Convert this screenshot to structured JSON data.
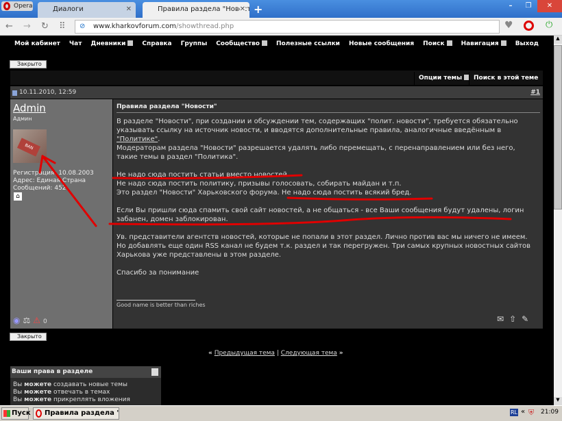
{
  "browser": {
    "name": "Opera",
    "tabs": [
      {
        "label": "Диалоги"
      },
      {
        "label": "Правила раздела \"Новости\""
      }
    ],
    "url_domain": "www.kharkovforum.com",
    "url_path": "/showthread.php"
  },
  "nav": [
    "Мой кабинет",
    "Чат",
    "Дневники",
    "Справка",
    "Группы",
    "Сообщество",
    "Полезные ссылки",
    "Новые сообщения",
    "Поиск",
    "Навигация",
    "Выход"
  ],
  "closed_label": "Закрыто",
  "thread_options": "Опции темы",
  "thread_search": "Поиск в этой теме",
  "post": {
    "date": "10.11.2010, 12:59",
    "number": "#1",
    "author": "Admin",
    "role": "Админ",
    "avatar_text": "BAN",
    "info": [
      "Регистрация: 10.08.2003",
      "Адрес: Единая Страна",
      "Сообщений: 452"
    ],
    "title": "Правила раздела \"Новости\"",
    "p1a": "В разделе \"Новости\", при создании и обсуждении тем, содержащих \"полит. новости\", требуется обязательно указывать ссылку на источник новости, и вводятся дополнительные правила, аналогичные введённым в ",
    "p1link": "\"Политике\"",
    "p1b": ".",
    "p2": "Модераторам раздела \"Новости\" разрешается удалять либо перемещать, с перенаправлением или без него, такие темы в раздел \"Политика\".",
    "p3": "Не надо сюда постить статьи вместо новостей.",
    "p4": "Не надо сюда постить политику, призывы голосовать, собирать майдан и т.п.",
    "p5a": "Это раздел \"Новости\" Харьковского форума. ",
    "p5b": "Не надо сюда постить всякий бред.",
    "p6": "Если Вы пришли сюда спамить свой сайт новостей, а не общаться - все Ваши сообщения будут удалены, логин забанен, домен заблокирован.",
    "p7": "Ув. представители агентств новостей, которые не попали в этот раздел. Лично против вас мы ничего не имеем. Но добавлять еще один RSS канал не будем т.к. раздел и так перегружен. Три самых крупных новостных сайтов Харькова уже представлены в этом разделе.",
    "p8": "Спасибо за понимание",
    "signature": "Good name is better than riches"
  },
  "prev": "Предыдущая тема",
  "next": "Следующая тема",
  "sep": "|",
  "laquo": "«",
  "raquo": "»",
  "rights": {
    "title": "Ваши права в разделе",
    "items": [
      {
        "a": "Вы ",
        "b": "можете",
        "c": " создавать новые темы"
      },
      {
        "a": "Вы ",
        "b": "можете",
        "c": " отвечать в темах"
      },
      {
        "a": "Вы ",
        "b": "можете",
        "c": " прикреплять вложения"
      }
    ]
  },
  "taskbar": {
    "start": "Пуск",
    "task": "Правила раздела \"Н...",
    "lang": "RL",
    "time": "21:09"
  },
  "colors": {
    "annotation": "#e00000",
    "tabbar": "#3a7ed6"
  }
}
